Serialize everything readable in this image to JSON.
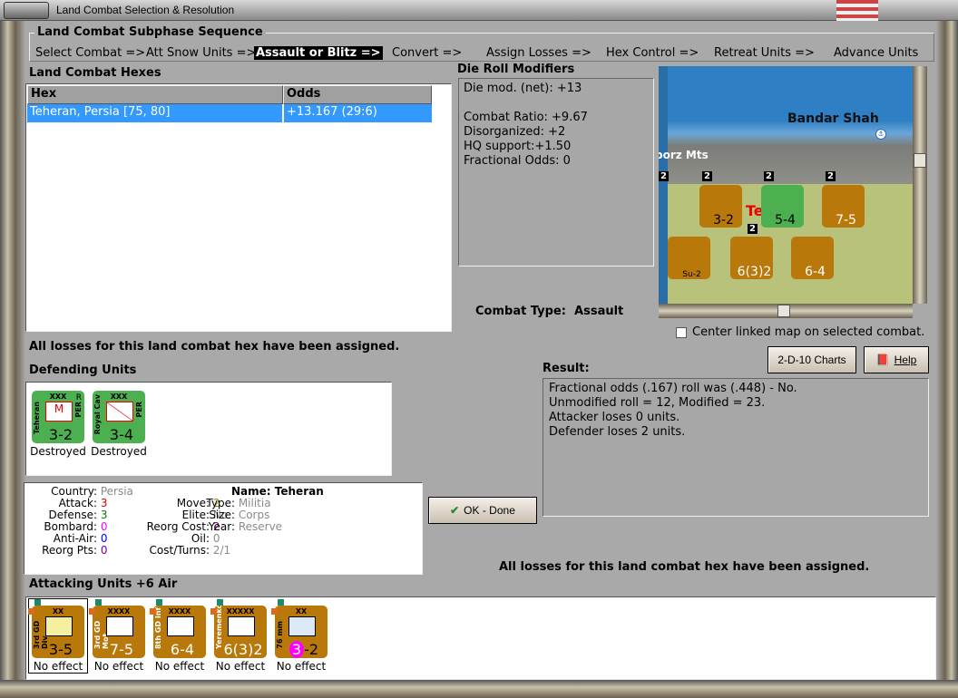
{
  "window": {
    "title": "Land Combat Selection & Resolution"
  },
  "subphase": {
    "title": "Land Combat Subphase Sequence",
    "steps": [
      "Select Combat =>",
      "Att Snow Units =>",
      "Assault or Blitz =>",
      "Convert =>",
      "Assign Losses =>",
      "Hex Control =>",
      "Retreat Units =>",
      "Advance Units"
    ],
    "active_index": 2
  },
  "hexes": {
    "title": "Land Combat Hexes",
    "columns": [
      "Hex",
      "Odds"
    ],
    "rows": [
      {
        "hex": "Teheran, Persia [75, 80]",
        "odds": "+13.167 (29:6)",
        "selected": true
      }
    ]
  },
  "modifiers": {
    "title": "Die Roll Modifiers",
    "lines": [
      "Die mod. (net): +13",
      "",
      "Combat Ratio: +9.67",
      "Disorganized: +2",
      "HQ support:+1.50",
      "Fractional Odds: 0"
    ]
  },
  "combat_type": {
    "label": "Combat Type:",
    "value": "Assault"
  },
  "map": {
    "labels": [
      "Bandar Shah",
      "borz Mts",
      "Tel"
    ],
    "stack_counts": [
      "2",
      "2",
      "2",
      "2",
      "2"
    ],
    "counters": [
      "3-2",
      "5-4",
      "7-5",
      "6(3)2",
      "6-4",
      "Su-2"
    ]
  },
  "center_map": {
    "label": "Center linked map on selected combat.",
    "checked": false
  },
  "buttons": {
    "charts": "2-D-10 Charts",
    "help": "Help",
    "ok": "OK - Done"
  },
  "losses_msg": "All losses for this land combat hex have been assigned.",
  "result": {
    "label": "Result:",
    "lines": [
      "Fractional odds (.167) roll was (.448)  - No.",
      "Unmodified roll = 12, Modified = 23.",
      "Attacker loses 0 units.",
      "Defender loses 2 units."
    ]
  },
  "defending": {
    "title": "Defending Units",
    "units": [
      {
        "name": "Teheran",
        "size": "XXX",
        "nation": "PER",
        "flag": "R",
        "strength": "3-2",
        "symbol": "M",
        "status": "Destroyed"
      },
      {
        "name": "Royal Cav",
        "size": "XXX",
        "nation": "PER",
        "flag": "",
        "strength": "3-4",
        "symbol": "",
        "status": "Destroyed"
      }
    ]
  },
  "unit_info": {
    "col1": [
      {
        "label": "Country:",
        "value": "Persia",
        "color": "#8a8a8a"
      },
      {
        "label": "Attack:",
        "value": "3",
        "color": "#e00000"
      },
      {
        "label": "Defense:",
        "value": "3",
        "color": "#008000"
      },
      {
        "label": "Bombard:",
        "value": "0",
        "color": "#ff00ff"
      },
      {
        "label": "Anti-Air:",
        "value": "0",
        "color": "#0000ff"
      },
      {
        "label": "Reorg Pts:",
        "value": "0",
        "color": "#800080"
      }
    ],
    "col2": [
      {
        "label": "Move:",
        "value": "2",
        "color": "#a08000"
      },
      {
        "label": "Elite:",
        "value": "No",
        "color": "#8a8a8a"
      },
      {
        "label": "Reorg Cost:",
        "value": "2",
        "color": "#800080"
      },
      {
        "label": "Oil:",
        "value": "0",
        "color": "#8a8a8a"
      },
      {
        "label": "Cost/Turns:",
        "value": "2/1",
        "color": "#8a8a8a"
      }
    ],
    "name_label": "Name:",
    "name": "Teheran",
    "col3": [
      {
        "label": "Type:",
        "value": "Militia",
        "color": "#8a8a8a"
      },
      {
        "label": "Size:",
        "value": "Corps",
        "color": "#8a8a8a"
      },
      {
        "label": "Year:",
        "value": "Reserve",
        "color": "#8a8a8a"
      }
    ]
  },
  "attacking": {
    "title": "Attacking Units +6 Air",
    "units": [
      {
        "name": "3rd GD Div",
        "size": "XX",
        "strength": "3-5",
        "status": "No effect"
      },
      {
        "name": "3rd GD Mot",
        "size": "XXXX",
        "strength": "7-5",
        "status": "No effect"
      },
      {
        "name": "8th GD Inf",
        "size": "XXXX",
        "strength": "6-4",
        "status": "No effect"
      },
      {
        "name": "Yeremenko",
        "size": "XXXXX",
        "strength": "6(3)2",
        "status": "No effect"
      },
      {
        "name": "76 mm",
        "size": "XX",
        "strength": "-2",
        "strength_badge": "3",
        "status": "No effect"
      }
    ]
  }
}
